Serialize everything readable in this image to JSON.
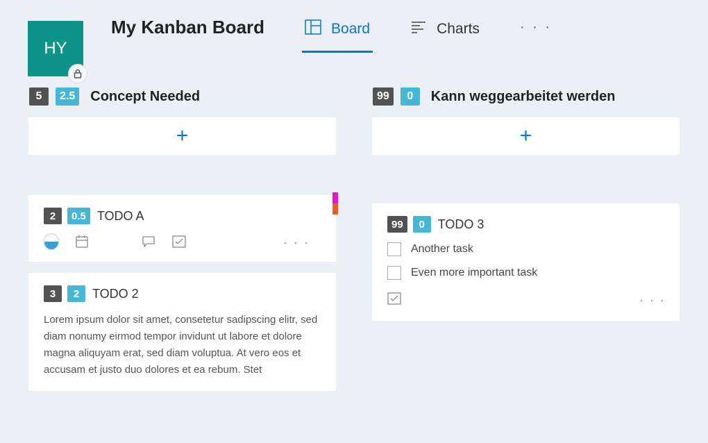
{
  "header": {
    "avatar": "HY",
    "title": "My Kanban Board",
    "tabs": [
      {
        "label": "Board",
        "active": true
      },
      {
        "label": "Charts",
        "active": false
      }
    ]
  },
  "columns": [
    {
      "badge1": "5",
      "badge2": "2.5",
      "title": "Concept Needed",
      "cards": [
        {
          "badge1": "2",
          "badge2": "0.5",
          "title": "TODO A",
          "strips": [
            "#e516c7",
            "#e85f2a"
          ],
          "icons": true
        },
        {
          "badge1": "3",
          "badge2": "2",
          "title": "TODO 2",
          "body": "Lorem ipsum dolor sit amet, consetetur sadipscing elitr, sed diam nonumy eirmod tempor invidunt ut labore et dolore magna aliquyam erat, sed diam voluptua. At vero eos et accusam et justo duo dolores et ea rebum. Stet"
        }
      ]
    },
    {
      "badge1": "99",
      "badge2": "0",
      "title": "Kann weggearbeitet werden",
      "cards": [
        {
          "badge1": "99",
          "badge2": "0",
          "title": "TODO 3",
          "tasks": [
            "Another task",
            "Even more important task"
          ]
        }
      ]
    }
  ]
}
